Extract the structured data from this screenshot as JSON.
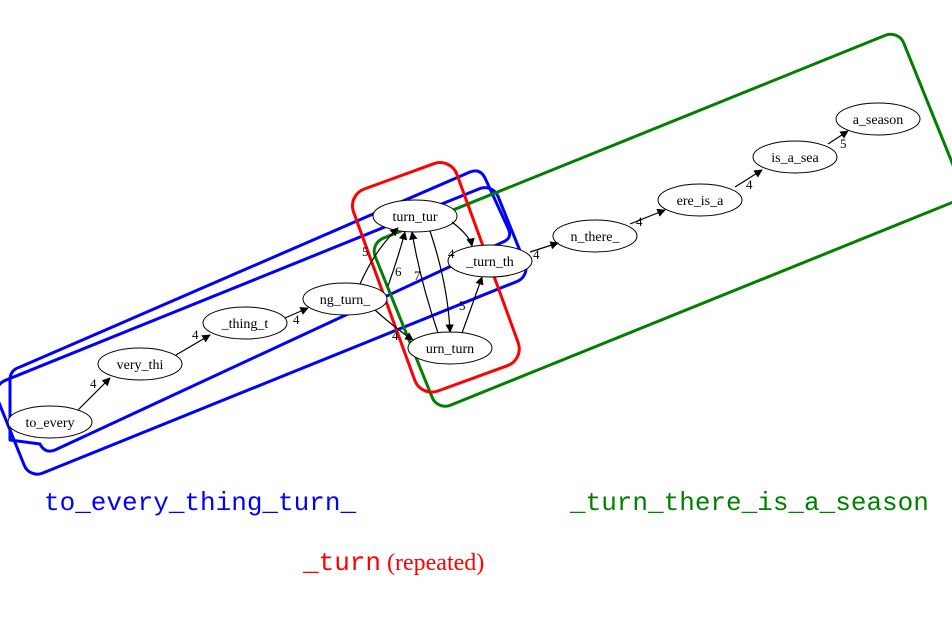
{
  "nodes": {
    "n0": "to_every",
    "n1": "very_thi",
    "n2": "_thing_t",
    "n3": "ng_turn_",
    "n4": "turn_tur",
    "n5": "urn_turn",
    "n6": "_turn_th",
    "n7": "n_there_",
    "n8": "ere_is_a",
    "n9": "is_a_sea",
    "n10": "a_season"
  },
  "edges": {
    "e0": "4",
    "e1": "4",
    "e2": "4",
    "e3": "5",
    "e4": "4",
    "e5": "4",
    "e6": "7",
    "e7": "6",
    "e8": "5",
    "e9": "4",
    "e10": "4",
    "e11": "4",
    "e12": "4",
    "e13": "5"
  },
  "captions": {
    "left": "to_every_thing_turn_",
    "right": "_turn_there_is_a_season",
    "bottom_code": "_turn",
    "bottom_plain": " (repeated)"
  },
  "colors": {
    "blue": "#0000ff",
    "green": "#008000",
    "red": "#ff0000"
  }
}
